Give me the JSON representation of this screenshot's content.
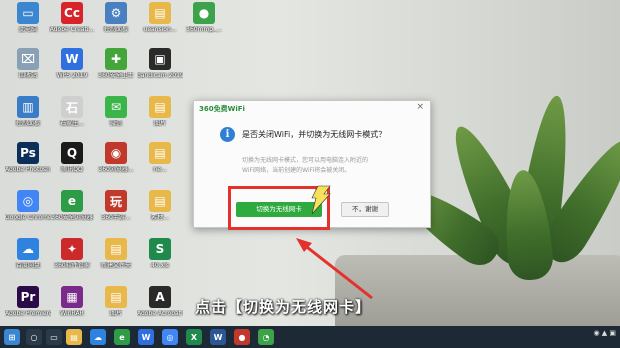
{
  "dialog": {
    "title": "360免费WiFi",
    "close": "×",
    "info_glyph": "i",
    "heading": "是否关闭WiFi，并切换为无线网卡模式？",
    "desc_line1": "切换为无线网卡模式，您可以用电脑连入附近的",
    "desc_line2": "WiFi网络，当前创建的WiFi将会被关闭。",
    "primary_button": "切换为无线网卡",
    "secondary_button": "不，谢谢"
  },
  "caption": "点击【切换为无线网卡】",
  "desktop_icons": [
    {
      "label": "此电脑",
      "color": "#3b86d1",
      "glyph": "▭"
    },
    {
      "label": "Adobe Creati...",
      "color": "#d8232a",
      "glyph": "Cc"
    },
    {
      "label": "控制面板",
      "color": "#4a7fc1",
      "glyph": "⚙"
    },
    {
      "label": "ueansion...",
      "color": "#e8b84a",
      "glyph": "▤"
    },
    {
      "label": "360mmp_...",
      "color": "#3da34a",
      "glyph": "●"
    },
    {
      "label": "回收站",
      "color": "#8aa0b4",
      "glyph": "⌧"
    },
    {
      "label": "WPS 2019",
      "color": "#2f6fe0",
      "glyph": "W"
    },
    {
      "label": "360安全卫士",
      "color": "#44a63a",
      "glyph": "✚"
    },
    {
      "label": "bandicam 2019-02-...",
      "color": "#2a2a2a",
      "glyph": "▣"
    },
    {
      "label": "控制面板",
      "color": "#3a7cc7",
      "glyph": "▥"
    },
    {
      "label": "石家庄...",
      "color": "#cfcfcf",
      "glyph": "石"
    },
    {
      "label": "微信",
      "color": "#3bb54a",
      "glyph": "✉"
    },
    {
      "label": "图片",
      "color": "#e8b84a",
      "glyph": "▤"
    },
    {
      "label": "Adobe Photosh...",
      "color": "#0c2f5a",
      "glyph": "Ps"
    },
    {
      "label": "腾讯QQ",
      "color": "#1a1a1a",
      "glyph": "Q"
    },
    {
      "label": "360浏览器...",
      "color": "#c0392b",
      "glyph": "◉"
    },
    {
      "label": "ne...",
      "color": "#e8b84a",
      "glyph": "▤"
    },
    {
      "label": "Google Chrome",
      "color": "#4285f4",
      "glyph": "◎"
    },
    {
      "label": "360安全浏览器",
      "color": "#2e9b46",
      "glyph": "e"
    },
    {
      "label": "360手游...",
      "color": "#c0392b",
      "glyph": "玩"
    },
    {
      "label": "素材...",
      "color": "#e8b84a",
      "glyph": "▤"
    },
    {
      "label": "百度网盘",
      "color": "#2f83e0",
      "glyph": "☁"
    },
    {
      "label": "360软件管家",
      "color": "#cc2a2a",
      "glyph": "✦"
    },
    {
      "label": "新建文件夹",
      "color": "#e8b84a",
      "glyph": "▤"
    },
    {
      "label": "40.xls",
      "color": "#1f8a4c",
      "glyph": "S"
    },
    {
      "label": "Adobe Premiere ...",
      "color": "#2a0a47",
      "glyph": "Pr"
    },
    {
      "label": "WinRAR",
      "color": "#7a2a8a",
      "glyph": "▦"
    },
    {
      "label": "图片",
      "color": "#e8b84a",
      "glyph": "▤"
    },
    {
      "label": "Adobe Acrobat DC",
      "color": "#2a2a2a",
      "glyph": "A"
    }
  ],
  "taskbar": {
    "items": [
      {
        "name": "start-icon",
        "color": "#3b86d1",
        "glyph": "⊞"
      },
      {
        "name": "search-icon",
        "color": "#2a3a48",
        "glyph": "○"
      },
      {
        "name": "task-view-icon",
        "color": "#2a3a48",
        "glyph": "▭"
      },
      {
        "name": "file-explorer-icon",
        "color": "#e8b84a",
        "glyph": "▤"
      },
      {
        "name": "baidu-netdisk-icon",
        "color": "#2f83e0",
        "glyph": "☁"
      },
      {
        "name": "360-browser-icon",
        "color": "#2e9b46",
        "glyph": "e"
      },
      {
        "name": "wps-icon",
        "color": "#2f6fe0",
        "glyph": "W"
      },
      {
        "name": "chrome-icon",
        "color": "#4285f4",
        "glyph": "◎"
      },
      {
        "name": "excel-icon",
        "color": "#1f8a4c",
        "glyph": "X"
      },
      {
        "name": "word-icon",
        "color": "#2b5797",
        "glyph": "W"
      },
      {
        "name": "record-icon",
        "color": "#c0392b",
        "glyph": "●"
      },
      {
        "name": "360-wifi-icon",
        "color": "#3da34a",
        "glyph": "◔"
      }
    ]
  },
  "colors": {
    "accent_green": "#2eaa3f",
    "highlight_red": "#e5312b",
    "info_blue": "#2f7fd6"
  }
}
